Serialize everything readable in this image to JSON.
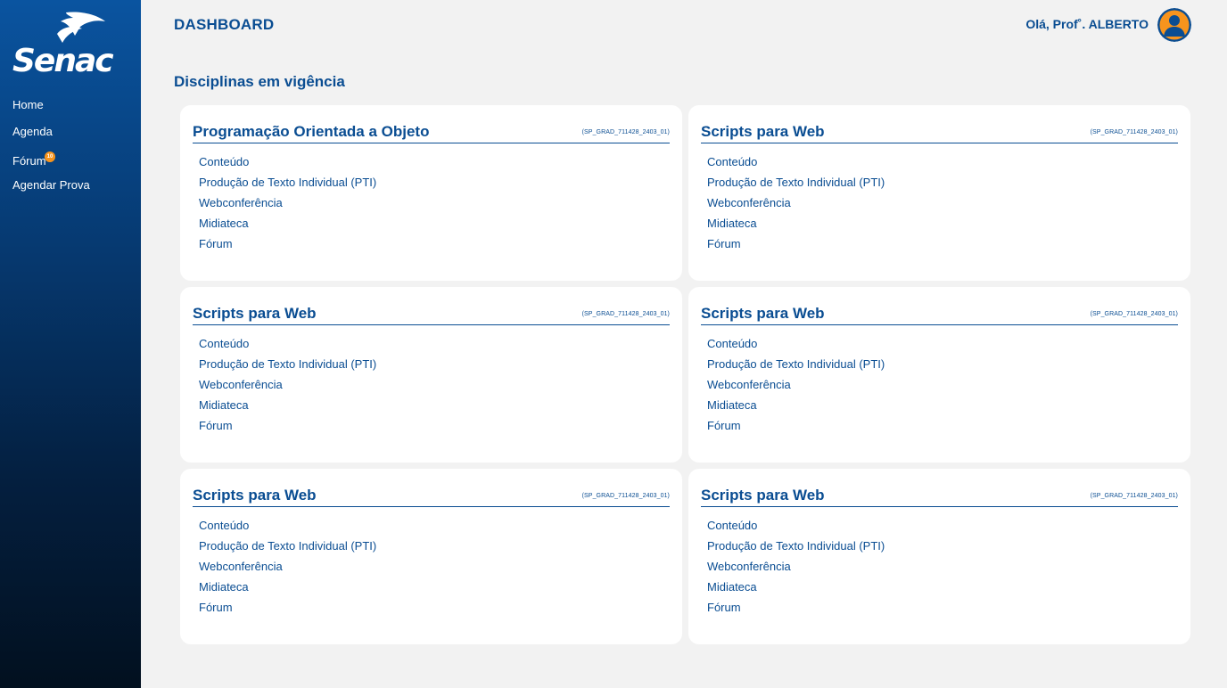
{
  "sidebar": {
    "logo_text": "Senac",
    "items": [
      {
        "label": "Home"
      },
      {
        "label": "Agenda"
      },
      {
        "label": "Fórum",
        "badge": "10"
      },
      {
        "label": "Agendar Prova"
      }
    ]
  },
  "header": {
    "title": "DASHBOARD",
    "greeting": "Olá, Prof˚. ALBERTO"
  },
  "main": {
    "section_title": "Disciplinas em vigência",
    "cards": [
      {
        "title": "Programação Orientada a Objeto",
        "code": "(SP_GRAD_711428_2403_01)",
        "links": [
          "Conteúdo",
          "Produção de Texto Individual (PTI)",
          "Webconferência",
          "Midiateca",
          "Fórum"
        ]
      },
      {
        "title": "Scripts para Web",
        "code": "(SP_GRAD_711428_2403_01)",
        "links": [
          "Conteúdo",
          "Produção de Texto Individual (PTI)",
          "Webconferência",
          "Midiateca",
          "Fórum"
        ]
      },
      {
        "title": "Scripts para Web",
        "code": "(SP_GRAD_711428_2403_01)",
        "links": [
          "Conteúdo",
          "Produção de Texto Individual (PTI)",
          "Webconferência",
          "Midiateca",
          "Fórum"
        ]
      },
      {
        "title": "Scripts para Web",
        "code": "(SP_GRAD_711428_2403_01)",
        "links": [
          "Conteúdo",
          "Produção de Texto Individual (PTI)",
          "Webconferência",
          "Midiateca",
          "Fórum"
        ]
      },
      {
        "title": "Scripts para Web",
        "code": "(SP_GRAD_711428_2403_01)",
        "links": [
          "Conteúdo",
          "Produção de Texto Individual (PTI)",
          "Webconferência",
          "Midiateca",
          "Fórum"
        ]
      },
      {
        "title": "Scripts para Web",
        "code": "(SP_GRAD_711428_2403_01)",
        "links": [
          "Conteúdo",
          "Produção de Texto Individual (PTI)",
          "Webconferência",
          "Midiateca",
          "Fórum"
        ]
      }
    ]
  },
  "colors": {
    "brand_blue": "#0a4d92",
    "accent_orange": "#f7941d",
    "background": "#f2f2f2"
  },
  "icons": {
    "logo": "senac-logo",
    "avatar": "user-avatar-icon"
  }
}
